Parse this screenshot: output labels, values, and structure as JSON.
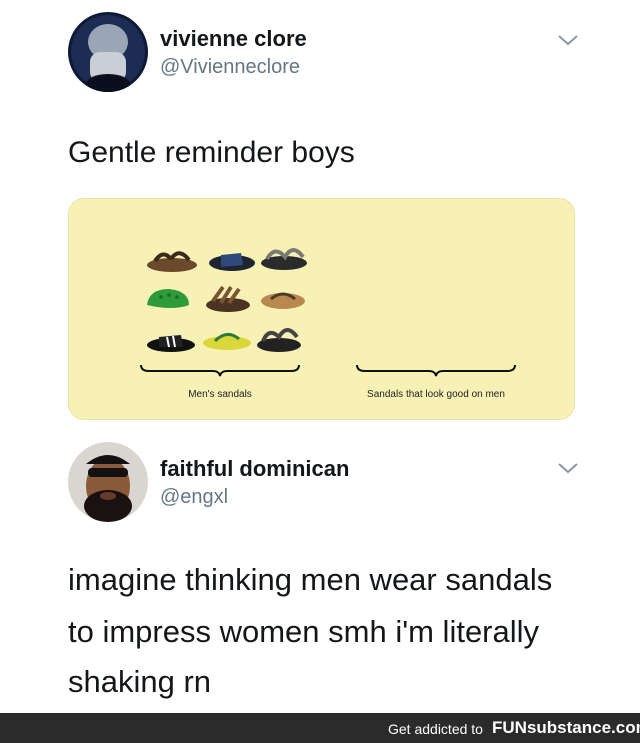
{
  "tweet1": {
    "display_name": "vivienne clore",
    "handle": "@Vivienneclore",
    "text": "Gentle reminder boys",
    "menu_icon": "chevron-down-icon"
  },
  "card": {
    "label_left": "Men's sandals",
    "label_right": "Sandals that look good on men",
    "sandal_icons": [
      "sandal-icon",
      "slide-icon",
      "sport-sandal-icon",
      "clog-icon",
      "sandal-icon",
      "flip-flop-icon",
      "slide-icon",
      "flip-flop-icon",
      "sport-sandal-icon"
    ]
  },
  "tweet2": {
    "display_name": "faithful dominican",
    "handle": "@engxl",
    "text_line1": "imagine thinking men wear sandals",
    "text_line2": "to impress women smh i'm literally",
    "text_line3": "shaking rn",
    "menu_icon": "chevron-down-icon"
  },
  "footer": {
    "text": "Get addicted to",
    "brand": "FUNsubstance.com"
  },
  "colors": {
    "card_bg": "#f8f1b6",
    "handle_gray": "#657786",
    "footer_bg": "#2b2b2b"
  }
}
